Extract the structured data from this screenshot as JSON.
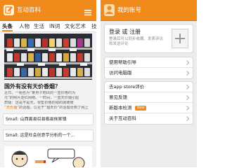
{
  "left_screen": {
    "nav": {
      "title": "互动百科",
      "icon": "hudong-logo-icon",
      "menu_icon": "hamburger-menu-icon"
    },
    "tabs": [
      {
        "label": "头条",
        "active": true
      },
      {
        "label": "人物",
        "active": false
      },
      {
        "label": "生活",
        "active": false
      },
      {
        "label": "IN词",
        "active": false
      },
      {
        "label": "文化艺术",
        "active": false
      },
      {
        "label": "技",
        "active": false
      }
    ],
    "lead_article": {
      "headline": "国外有没有天价香烟？",
      "excerpt_lines": [
        "近日，一组名为“某男子晒出的一盒价格约为",
        "元”的照片走红网络。一时间，一盒天价烟引起",
        "质疑：这是不是天，零售价格的城的城坡坡",
        "的话题，以至于“烟天价”的话题全到了网上"
      ],
      "highlight_text": "“天价烟”"
    },
    "list_items": [
      {
        "title": "Small: 山西离县召县临县侯家镇"
      },
      {
        "title": "Small: 这是社会创意学分析的一个…"
      }
    ]
  },
  "right_screen": {
    "nav": {
      "title": "我的账号",
      "back_icon": "back-arrow-icon"
    },
    "profile": {
      "login_label": "登录 或 注册",
      "hint": "登录后可以同步收藏、发表评论和发送评论",
      "avatar_icon": "avatar-placeholder-icon"
    },
    "menu_groups": [
      {
        "items": [
          {
            "label": "使用帮助引导"
          },
          {
            "label": "访问电脑版"
          }
        ]
      },
      {
        "items": [
          {
            "label": "去app store评价"
          },
          {
            "label": "意见反馈"
          },
          {
            "label": "新版本检测",
            "badge": "New"
          },
          {
            "label": "关于互动百科"
          }
        ]
      }
    ]
  },
  "colors": {
    "accent": "#f08a1a",
    "nav_text": "#ffffff",
    "highlight": "#e1720e",
    "page_bg": "#ececec"
  }
}
